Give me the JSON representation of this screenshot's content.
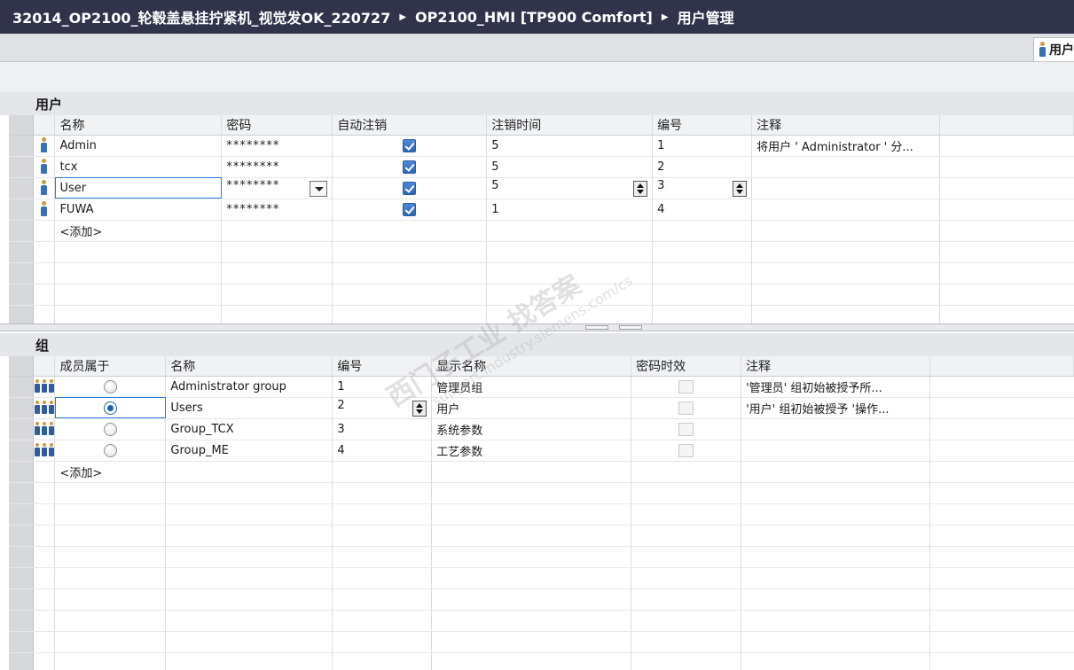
{
  "titlebar": {
    "crumbs": [
      "32014_OP2100_轮毂盖悬挂拧紧机_视觉发OK_220727",
      "OP2100_HMI [TP900 Comfort]",
      "用户管理"
    ]
  },
  "tabs": {
    "users_tab": "用户"
  },
  "users_section": {
    "title": "用户",
    "columns": [
      "名称",
      "密码",
      "自动注销",
      "注销时间",
      "编号",
      "注释"
    ],
    "rows": [
      {
        "name": "Admin",
        "password": "********",
        "auto_logoff": true,
        "logoff_time": "5",
        "number": "1",
        "comment": "将用户 ' Administrator ' 分..."
      },
      {
        "name": "tcx",
        "password": "********",
        "auto_logoff": true,
        "logoff_time": "5",
        "number": "2",
        "comment": ""
      },
      {
        "name": "User",
        "password": "********",
        "auto_logoff": true,
        "logoff_time": "5",
        "number": "3",
        "comment": ""
      },
      {
        "name": "FUWA",
        "password": "********",
        "auto_logoff": true,
        "logoff_time": "1",
        "number": "4",
        "comment": ""
      }
    ],
    "add_label": "<添加>"
  },
  "groups_section": {
    "title": "组",
    "columns": [
      "成员属于",
      "名称",
      "编号",
      "显示名称",
      "密码时效",
      "注释"
    ],
    "rows": [
      {
        "member": false,
        "name": "Administrator group",
        "number": "1",
        "display_name": "管理员组",
        "password_aging": false,
        "comment": "'管理员' 组初始被授予所..."
      },
      {
        "member": true,
        "name": "Users",
        "number": "2",
        "display_name": "用户",
        "password_aging": false,
        "comment": "'用户' 组初始被授予 '操作..."
      },
      {
        "member": false,
        "name": "Group_TCX",
        "number": "3",
        "display_name": "系统参数",
        "password_aging": false,
        "comment": ""
      },
      {
        "member": false,
        "name": "Group_ME",
        "number": "4",
        "display_name": "工艺参数",
        "password_aging": false,
        "comment": ""
      }
    ],
    "add_label": "<添加>"
  },
  "watermark": {
    "line1": "西门子工业  找答案",
    "line2": "support.industry.siemens.com/cs"
  }
}
